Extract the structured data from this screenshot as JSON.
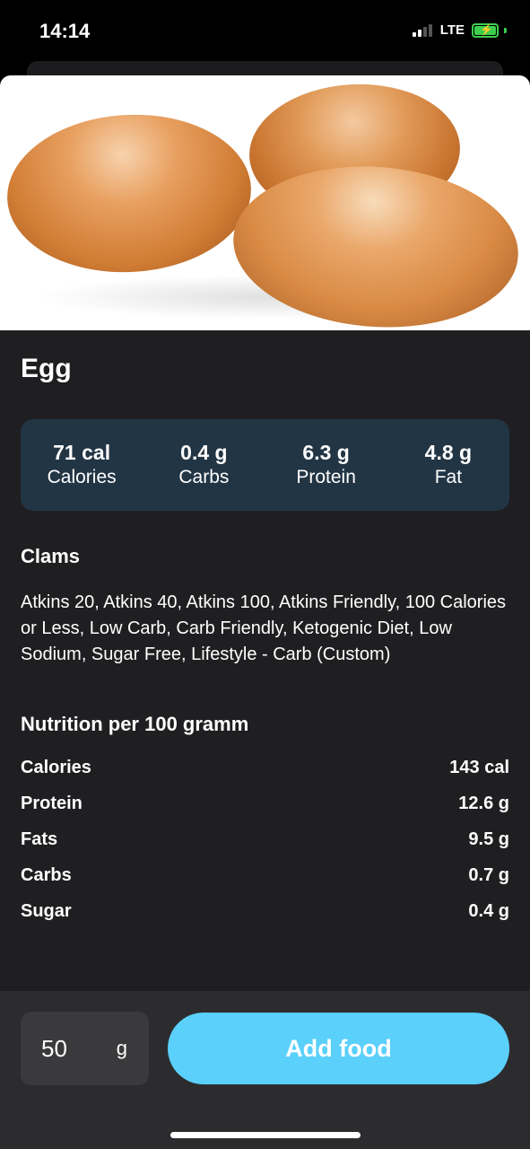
{
  "status_bar": {
    "time": "14:14",
    "network": "LTE",
    "signal_bars_active": 2,
    "signal_bars_total": 4,
    "battery_color": "#3ccf4e",
    "battery_icon": "battery-charging-icon"
  },
  "food": {
    "name": "Egg",
    "image_icon": "eggs-image"
  },
  "macros": [
    {
      "value": "71 cal",
      "label": "Calories"
    },
    {
      "value": "0.4 g",
      "label": "Carbs"
    },
    {
      "value": "6.3 g",
      "label": "Protein"
    },
    {
      "value": "4.8 g",
      "label": "Fat"
    }
  ],
  "claims": {
    "title": "Clams",
    "text": "Atkins 20, Atkins 40, Atkins 100, Atkins Friendly, 100 Calories or Less, Low Carb, Carb Friendly, Ketogenic Diet, Low Sodium, Sugar Free, Lifestyle - Carb (Custom)"
  },
  "nutrition": {
    "title": "Nutrition per 100 gramm",
    "rows": [
      {
        "label": "Calories",
        "value": "143 cal"
      },
      {
        "label": "Protein",
        "value": "12.6 g"
      },
      {
        "label": "Fats",
        "value": "9.5 g"
      },
      {
        "label": "Carbs",
        "value": "0.7 g"
      },
      {
        "label": "Sugar",
        "value": "0.4 g"
      }
    ]
  },
  "footer": {
    "quantity_value": "50",
    "quantity_unit": "g",
    "add_label": "Add food",
    "accent_color": "#5ad0fb"
  }
}
